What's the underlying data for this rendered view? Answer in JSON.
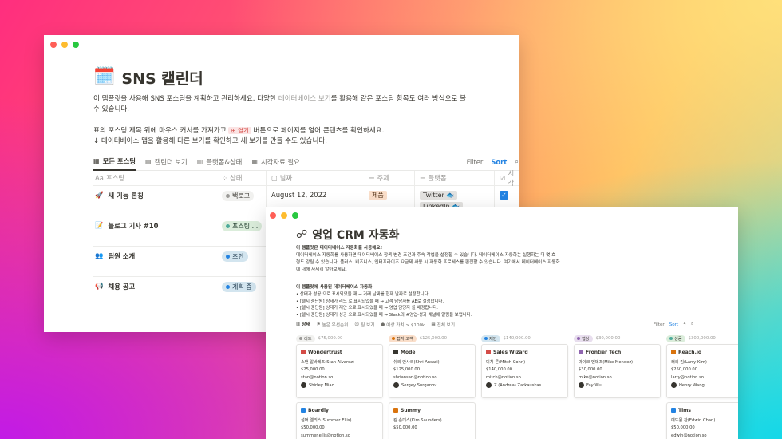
{
  "window1": {
    "title_emoji": "🗓️",
    "title": "SNS 캘린더",
    "desc1_pre": "이 템플릿을 사용해 SNS 포스팅을 계획하고 관리하세요. 다양한 ",
    "desc1_link": "데이터베이스 보기",
    "desc1_post": "를 활용해 같은 포스팅 항목도 여러 방식으로 볼 수 있습니다.",
    "desc2_pre": "표의 포스팅 제목 위에 마우스 커서를 가져가고 ",
    "desc2_tag": "열기",
    "desc2_post": " 버튼으로 페이지를 열어 콘텐츠를 확인하세요.",
    "desc3": "↓ 데이터베이스 탭을 활용해 다른 보기를 확인하고 새 보기를 만들 수도 있습니다.",
    "tabs": [
      {
        "label": "모든 포스팅",
        "icon": "table-icon"
      },
      {
        "label": "캘린더 보기",
        "icon": "calendar-icon"
      },
      {
        "label": "플랫폼&상태",
        "icon": "board-icon"
      },
      {
        "label": "시각자료 필요",
        "icon": "table-icon"
      }
    ],
    "filter_label": "Filter",
    "sort_label": "Sort",
    "columns": [
      "포스팅",
      "상태",
      "날짜",
      "주제",
      "플랫폼",
      "시각"
    ],
    "rows": [
      {
        "emoji": "🚀",
        "title": "새 기능 론칭",
        "status": "백로그",
        "date": "August 12, 2022",
        "topic": "제품",
        "platforms": [
          "Twitter 🐟",
          "LinkedIn 🐟"
        ],
        "checked": true
      },
      {
        "emoji": "📝",
        "title": "블로그 기사 #10",
        "status": "포스팅 ...",
        "date": "",
        "topic": "",
        "platforms": [],
        "checked": false
      },
      {
        "emoji": "👥",
        "title": "팀원 소개",
        "status": "초안",
        "date": "",
        "topic": "",
        "platforms": [],
        "checked": false
      },
      {
        "emoji": "📢",
        "title": "채용 공고",
        "status": "계획 중",
        "date": "",
        "topic": "",
        "platforms": [],
        "checked": false
      }
    ]
  },
  "window2": {
    "title": "영업 CRM 자동화",
    "intro_bold": "이 템플릿은 데이터베이스 자동화를 사용해요!",
    "intro_1": "데이터베이스 자동화를 사용하면 데이터베이스 항목 변경 조건과 후속 작업을 설정할 수 있습니다. 데이터베이스 자동화는 실행하는 더 몇 효",
    "intro_2": "형도 강릴 수 있습니다. 플러스, 비즈니스, 엔터프라이즈 요금제 사용 시 자동화 프로세스를 편집할 수 있습니다. 여기에서 데이터베이스 자동화",
    "intro_3": "에 대해 자세히 알아보세요.",
    "sub_title": "이 템플릿에 사용된 데이터베이스 자동화",
    "list": [
      "상태가 성공 으로 표시되었을 때 → 거래 날짜를 현재 날짜로 설정합니다.",
      "[텔시 중단됨] 상태가 리드 로 표시되었을 때 → 고객 담당자를 AE로 설정합니다.",
      "[텔시 중단됨] 상태가 제안 으로 표시되었을 때 → 영업 담당자 를 배정합니다.",
      "[텔시 중단됨] 상태가 성공 으로 표시되었을 때 → Slack의 #영업-성과 채널에 알림을 보냅니다."
    ],
    "tabs": [
      {
        "label": "상태",
        "icon": "board-icon"
      },
      {
        "label": "높은 우선순위",
        "icon": "flag-icon"
      },
      {
        "label": "팀 보기",
        "icon": "people-icon"
      },
      {
        "label": "예상 가치 > $100k",
        "icon": "dollar-icon"
      },
      {
        "label": "전체 보기",
        "icon": "table-icon"
      }
    ],
    "filter_label": "Filter",
    "sort_label": "Sort",
    "columns": [
      {
        "status": "리드",
        "amount": "$75,000.00",
        "color": "#f1f1ef",
        "dot": "#9b9a97"
      },
      {
        "status": "접지 고객",
        "amount": "$125,000.00",
        "color": "#fadec9",
        "dot": "#d9730d"
      },
      {
        "status": "제안",
        "amount": "$140,000.00",
        "color": "#d3e5ef",
        "dot": "#2383e2"
      },
      {
        "status": "협상",
        "amount": "$30,000.00",
        "color": "#e8deee",
        "dot": "#9065b0"
      },
      {
        "status": "성공",
        "amount": "$300,000.00",
        "color": "#dbeddb",
        "dot": "#4dab9a"
      }
    ],
    "cards": [
      [
        {
          "name": "Wondertrust",
          "icon_color": "#d44c47",
          "contact": "스탠 알바레즈(Stan Alvarez)",
          "value": "$25,000.00",
          "email": "stan@notion.so",
          "owner": "Shirley Miao"
        },
        {
          "name": "Boardly",
          "icon_color": "#2383e2",
          "contact": "섬머 엘리스(Summer Ellis)",
          "value": "$50,000.00",
          "email": "summer.ellis@notion.so",
          "owner": ""
        }
      ],
      [
        {
          "name": "Mode",
          "icon_color": "#37352f",
          "contact": "쉬리 안사리(Shri Ansari)",
          "value": "$125,000.00",
          "email": "shriansari@notion.so",
          "owner": "Sergey Surganov"
        },
        {
          "name": "Summy",
          "icon_color": "#d9730d",
          "contact": "킴 손더스(Kim Saunders)",
          "value": "$50,000.00",
          "email": "",
          "owner": ""
        }
      ],
      [
        {
          "name": "Sales Wizard",
          "icon_color": "#d44c47",
          "contact": "미치 콘(Mitch Cohn)",
          "value": "$140,000.00",
          "email": "mitch@notion.so",
          "owner": "Z (Andrea) Zarkauskas"
        }
      ],
      [
        {
          "name": "Frontier Tech",
          "icon_color": "#9065b0",
          "contact": "마이크 멘데즈(Mike Mendez)",
          "value": "$30,000.00",
          "email": "mike@notion.so",
          "owner": "Fay Wu"
        }
      ],
      [
        {
          "name": "Reach.io",
          "icon_color": "#d9730d",
          "contact": "래리 킴(Larry Kim)",
          "value": "$250,000.00",
          "email": "larry@notion.so",
          "owner": "Henry Wang"
        },
        {
          "name": "Tims",
          "icon_color": "#2383e2",
          "contact": "에드윈 찬(Edwin Chan)",
          "value": "$50,000.00",
          "email": "edwin@notion.so",
          "owner": ""
        }
      ]
    ]
  }
}
